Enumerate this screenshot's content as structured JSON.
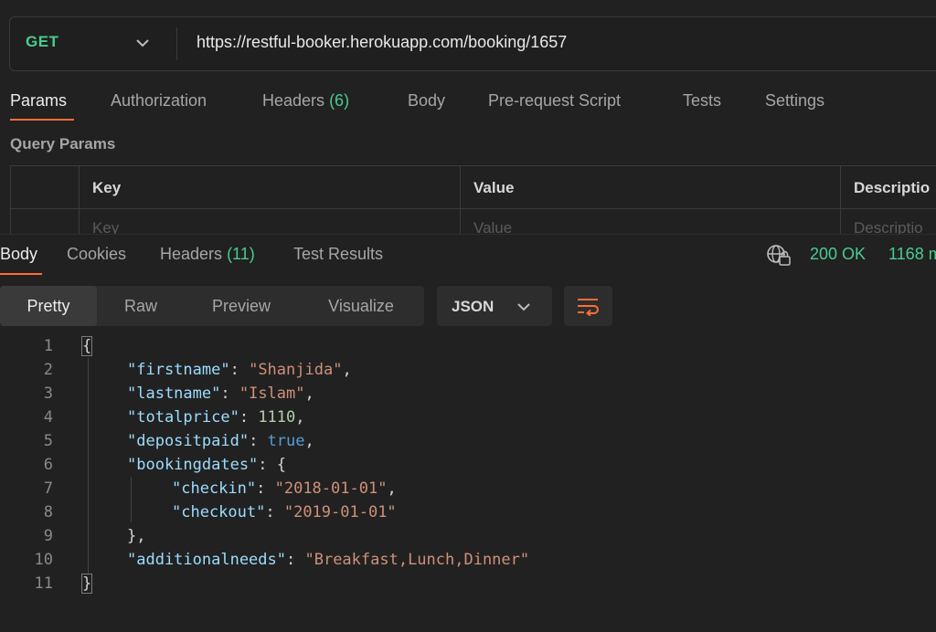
{
  "request": {
    "method": "GET",
    "url": "https://restful-booker.herokuapp.com/booking/1657"
  },
  "request_tabs": [
    {
      "label": "Params",
      "count": "",
      "active": true
    },
    {
      "label": "Authorization",
      "count": ""
    },
    {
      "label": "Headers",
      "count": "(6)"
    },
    {
      "label": "Body",
      "count": ""
    },
    {
      "label": "Pre-request Script",
      "count": ""
    },
    {
      "label": "Tests",
      "count": ""
    },
    {
      "label": "Settings",
      "count": ""
    }
  ],
  "query_params": {
    "title": "Query Params",
    "columns": [
      "Key",
      "Value",
      "Descriptio"
    ],
    "placeholders": [
      "Key",
      "Value",
      "Descriptio"
    ]
  },
  "response_tabs": [
    {
      "label": "Body",
      "count": "",
      "active": true
    },
    {
      "label": "Cookies",
      "count": ""
    },
    {
      "label": "Headers",
      "count": "(11)"
    },
    {
      "label": "Test Results",
      "count": ""
    }
  ],
  "response_meta": {
    "status": "200 OK",
    "time": "1168 m"
  },
  "view_modes": [
    "Pretty",
    "Raw",
    "Preview",
    "Visualize"
  ],
  "format": "JSON",
  "colors": {
    "accent": "#ff6c37",
    "success": "#49cc90",
    "background": "#212121"
  },
  "icons": {
    "method_dropdown": "chevron-down-icon",
    "format_dropdown": "chevron-down-icon",
    "wrap": "wrap-lines-icon",
    "network": "globe-lock-icon"
  },
  "code": {
    "line_numbers": [
      "1",
      "2",
      "3",
      "4",
      "5",
      "6",
      "7",
      "8",
      "9",
      "10",
      "11"
    ],
    "lines": {
      "l1_open": "{",
      "firstname_key": "\"firstname\"",
      "firstname_val": "\"Shanjida\"",
      "lastname_key": "\"lastname\"",
      "lastname_val": "\"Islam\"",
      "totalprice_key": "\"totalprice\"",
      "totalprice_val": "1110",
      "depositpaid_key": "\"depositpaid\"",
      "depositpaid_val": "true",
      "bookingdates_key": "\"bookingdates\"",
      "checkin_key": "\"checkin\"",
      "checkin_val": "\"2018-01-01\"",
      "checkout_key": "\"checkout\"",
      "checkout_val": "\"2019-01-01\"",
      "additionalneeds_key": "\"additionalneeds\"",
      "additionalneeds_val": "\"Breakfast,Lunch,Dinner\"",
      "l11_close": "}"
    }
  }
}
